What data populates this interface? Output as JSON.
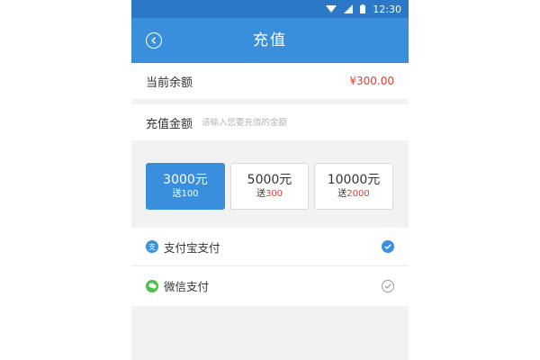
{
  "status_bar": {
    "time": "12:30",
    "icons": [
      "wifi-icon",
      "signal-icon",
      "battery-icon"
    ]
  },
  "app_bar": {
    "title": "充值",
    "back_icon": "back-circle-icon"
  },
  "balance": {
    "label": "当前余额",
    "value": "¥300.00"
  },
  "recharge": {
    "label": "充值金额",
    "placeholder": "请输入您要充值的金额",
    "value": ""
  },
  "options": [
    {
      "amount": "3000元",
      "bonus_prefix": "送",
      "bonus": "100",
      "selected": true
    },
    {
      "amount": "5000元",
      "bonus_prefix": "送",
      "bonus": "300",
      "selected": false
    },
    {
      "amount": "10000元",
      "bonus_prefix": "送",
      "bonus": "2000",
      "selected": false
    }
  ],
  "payment_methods": [
    {
      "label": "支付宝支付",
      "icon": "alipay-icon",
      "icon_glyph": "支",
      "icon_color": "#3a8fdc",
      "checked": true
    },
    {
      "label": "微信支付",
      "icon": "wechat-icon",
      "icon_glyph": "",
      "icon_color": "#4cc04c",
      "checked": false
    }
  ],
  "colors": {
    "primary": "#3a8fdc",
    "status_bar": "#2b78c6",
    "accent_red": "#e33b2f",
    "background": "#f2f2f2"
  }
}
